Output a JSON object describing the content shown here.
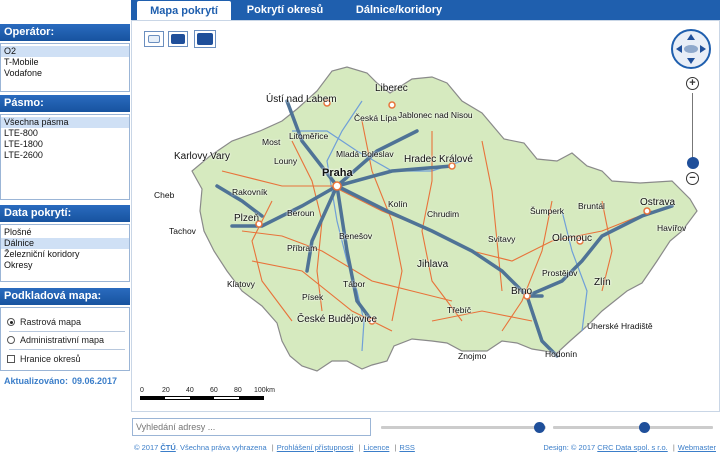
{
  "tabs": [
    "Mapa pokrytí",
    "Pokrytí okresů",
    "Dálnice/koridory"
  ],
  "operator": {
    "title": "Operátor:",
    "items": [
      "O2",
      "T-Mobile",
      "Vodafone"
    ],
    "selected": 0
  },
  "pasmo": {
    "title": "Pásmo:",
    "items": [
      "Všechna pásma",
      "LTE-800",
      "LTE-1800",
      "LTE-2600"
    ],
    "selected": 0
  },
  "data_pokryti": {
    "title": "Data pokrytí:",
    "items": [
      "Plošné",
      "Dálnice",
      "Železniční koridory",
      "Okresy"
    ],
    "selected": 1
  },
  "podkladova": {
    "title": "Podkladová mapa:",
    "options": [
      "Rastrová mapa",
      "Administrativní mapa"
    ],
    "selected": 0,
    "checkbox": "Hranice okresů",
    "checked": false
  },
  "updated": {
    "label": "Aktualizováno:",
    "date": "09.06.2017"
  },
  "map": {
    "cities": [
      "Ústí nad Labem",
      "Liberec",
      "Česká Lípa",
      "Jablonec nad Nisou",
      "Litoměřice",
      "Most",
      "Mladá Boleslav",
      "Karlovy Vary",
      "Louny",
      "Praha",
      "Hradec Králové",
      "Cheb",
      "Rakovník",
      "Kolín",
      "Chrudim",
      "Šumperk",
      "Bruntál",
      "Ostrava",
      "Plzeň",
      "Beroun",
      "Havířov",
      "Tachov",
      "Benešov",
      "Svitavy",
      "Olomouc",
      "Příbram",
      "Jihlava",
      "Prostějov",
      "Klatovy",
      "Tábor",
      "Zlín",
      "Písek",
      "Brno",
      "Třebíč",
      "České Budějovice",
      "Uherské Hradiště",
      "Znojmo",
      "Hodonín"
    ],
    "scale_labels": [
      "0",
      "20",
      "40",
      "60",
      "80",
      "100km"
    ],
    "colors": {
      "roads": "#e8733a",
      "highways": "#4f7396",
      "rivers": "#6f9fd8",
      "coverage": "#d3e9b8"
    }
  },
  "search": {
    "placeholder": "Vyhledání adresy ..."
  },
  "sliders": {
    "opacity_a": 0.93,
    "opacity_b": 0.57
  },
  "footer": {
    "copyright": "© 2017",
    "org": "ČTÚ",
    "rights": ". Všechna práva vyhrazena",
    "links": [
      "Prohlášení přístupnosti",
      "Licence",
      "RSS"
    ],
    "design": "Design: © 2017",
    "design_link": "CRC Data spol. s r.o.",
    "webmaster": "Webmaster"
  }
}
